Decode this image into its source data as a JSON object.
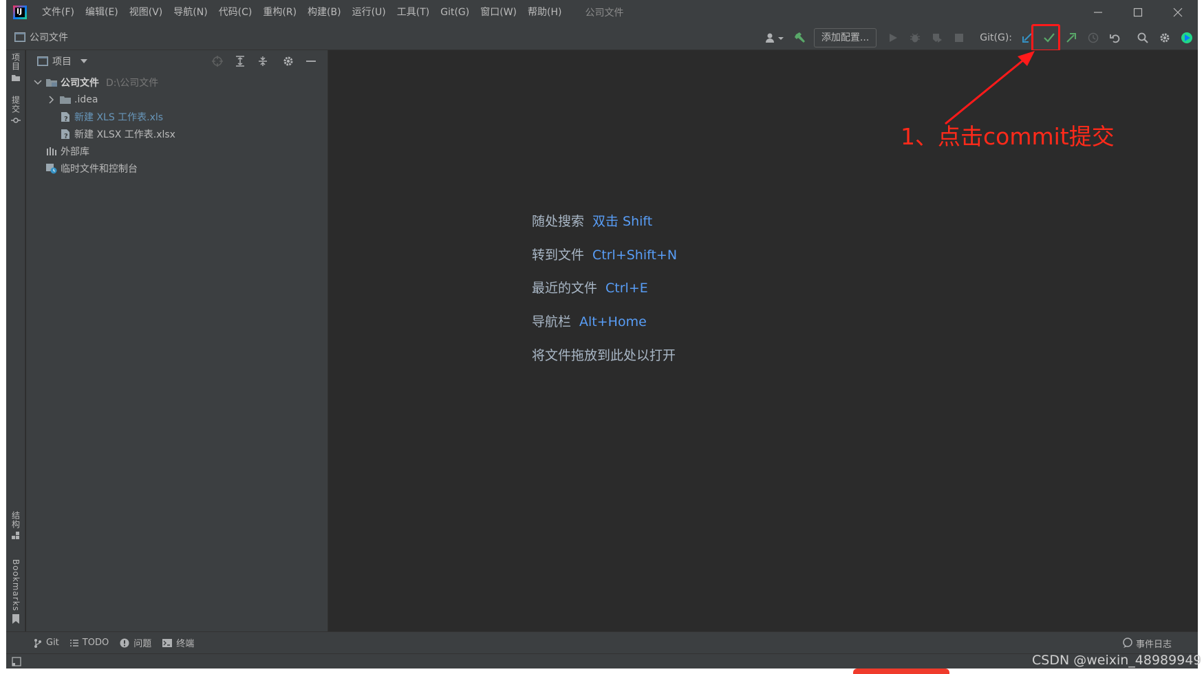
{
  "window": {
    "title": "公司文件",
    "menu": [
      "文件(F)",
      "编辑(E)",
      "视图(V)",
      "导航(N)",
      "代码(C)",
      "重构(R)",
      "构建(B)",
      "运行(U)",
      "工具(T)",
      "Git(G)",
      "窗口(W)",
      "帮助(H)"
    ],
    "logo_text": "IJ"
  },
  "toolbar": {
    "project_name": "公司文件",
    "add_config_label": "添加配置...",
    "git_label": "Git(G):"
  },
  "side_tabs": {
    "project": "项目",
    "commit": "提交",
    "structure": "结构",
    "bookmarks": "Bookmarks"
  },
  "project_panel": {
    "title": "项目",
    "tree": [
      {
        "label": "公司文件",
        "path": "D:\\公司文件"
      },
      {
        "label": ".idea"
      },
      {
        "label": "新建 XLS 工作表.xls"
      },
      {
        "label": "新建 XLSX 工作表.xlsx"
      },
      {
        "label": "外部库"
      },
      {
        "label": "临时文件和控制台"
      }
    ]
  },
  "editor_hints": [
    {
      "text": "随处搜索",
      "shortcut": "双击 Shift"
    },
    {
      "text": "转到文件",
      "shortcut": "Ctrl+Shift+N"
    },
    {
      "text": "最近的文件",
      "shortcut": "Ctrl+E"
    },
    {
      "text": "导航栏",
      "shortcut": "Alt+Home"
    },
    {
      "text": "将文件拖放到此处以打开",
      "shortcut": ""
    }
  ],
  "annotation": {
    "text": "1、点击commit提交",
    "color": "#ff2a1a"
  },
  "bottom_tabs": [
    "Git",
    "TODO",
    "问题",
    "终端"
  ],
  "event_log_label": "事件日志",
  "watermark": "CSDN @weixin_48989949",
  "colors": {
    "accent_blue": "#589df6",
    "commit_green": "#59a869",
    "annotation_red": "#ff2a1a"
  }
}
